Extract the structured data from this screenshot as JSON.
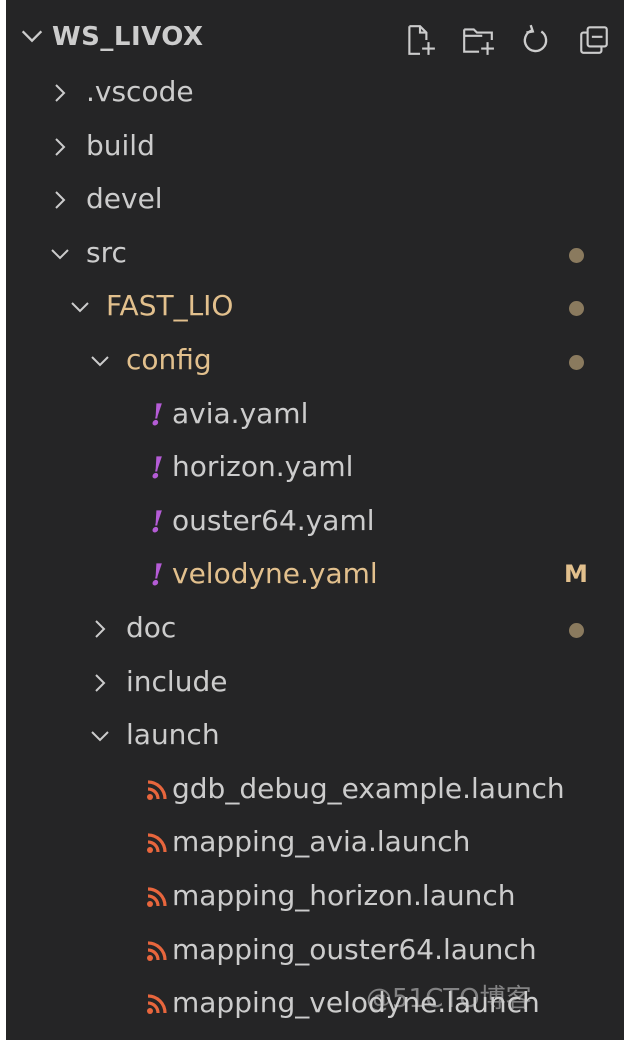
{
  "explorer": {
    "title": "WS_LIVOX",
    "actions": [
      {
        "name": "new-file-icon"
      },
      {
        "name": "new-folder-icon"
      },
      {
        "name": "refresh-icon"
      },
      {
        "name": "collapse-all-icon"
      }
    ],
    "tree": [
      {
        "label": ".vscode",
        "type": "folder",
        "expanded": false,
        "depth": 0
      },
      {
        "label": "build",
        "type": "folder",
        "expanded": false,
        "depth": 0
      },
      {
        "label": "devel",
        "type": "folder",
        "expanded": false,
        "depth": 0
      },
      {
        "label": "src",
        "type": "folder",
        "expanded": true,
        "depth": 0,
        "status": "dot"
      },
      {
        "label": "FAST_LIO",
        "type": "folder",
        "expanded": true,
        "depth": 1,
        "status": "dot",
        "modified": true
      },
      {
        "label": "config",
        "type": "folder",
        "expanded": true,
        "depth": 2,
        "status": "dot",
        "modified": true
      },
      {
        "label": "avia.yaml",
        "type": "yaml",
        "depth": 3
      },
      {
        "label": "horizon.yaml",
        "type": "yaml",
        "depth": 3
      },
      {
        "label": "ouster64.yaml",
        "type": "yaml",
        "depth": 3
      },
      {
        "label": "velodyne.yaml",
        "type": "yaml",
        "depth": 3,
        "status": "M",
        "modified": true
      },
      {
        "label": "doc",
        "type": "folder",
        "expanded": false,
        "depth": 2,
        "status": "dot"
      },
      {
        "label": "include",
        "type": "folder",
        "expanded": false,
        "depth": 2
      },
      {
        "label": "launch",
        "type": "folder",
        "expanded": true,
        "depth": 2
      },
      {
        "label": "gdb_debug_example.launch",
        "type": "launch",
        "depth": 3
      },
      {
        "label": "mapping_avia.launch",
        "type": "launch",
        "depth": 3
      },
      {
        "label": "mapping_horizon.launch",
        "type": "launch",
        "depth": 3
      },
      {
        "label": "mapping_ouster64.launch",
        "type": "launch",
        "depth": 3
      },
      {
        "label": "mapping_velodyne.launch",
        "type": "launch",
        "depth": 3
      }
    ]
  },
  "watermark": "@51CTO博客",
  "colors": {
    "background": "#252526",
    "text": "#cccccc",
    "modified": "#e2c08d",
    "yaml_icon": "#b55cd6",
    "launch_icon": "#e8663d"
  }
}
